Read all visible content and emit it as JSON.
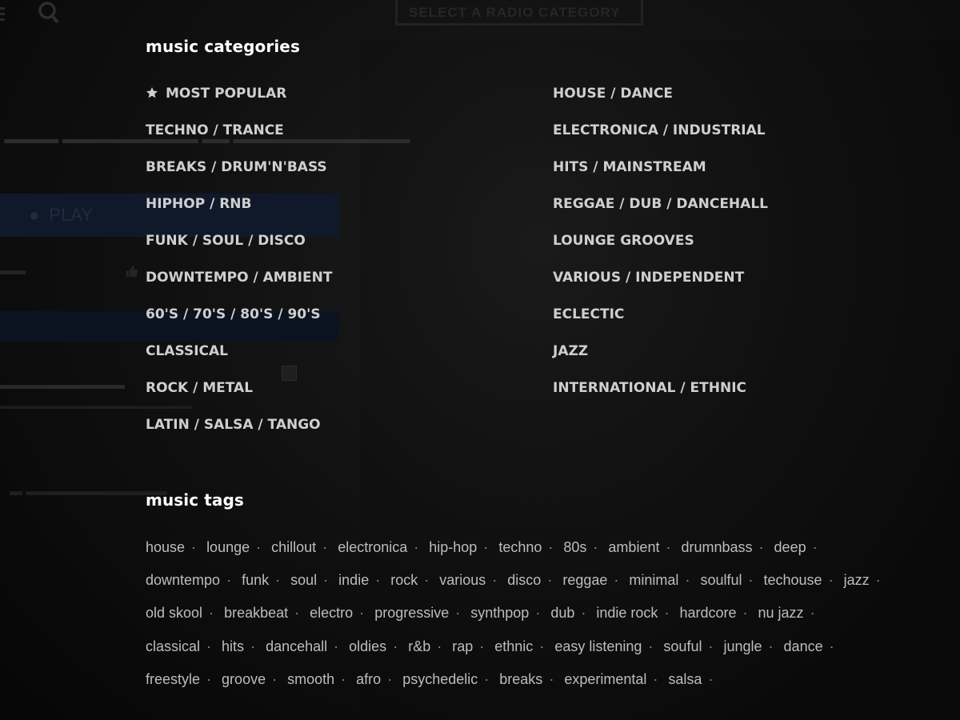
{
  "background": {
    "category_select_label": "SELECT A RADIO CATEGORY",
    "play_label": "PLAY"
  },
  "categories": {
    "heading": "music categories",
    "left": [
      {
        "label": "MOST POPULAR",
        "icon": "star-icon"
      },
      {
        "label": "TECHNO / TRANCE"
      },
      {
        "label": "BREAKS / DRUM'N'BASS"
      },
      {
        "label": "HIPHOP / RNB"
      },
      {
        "label": "FUNK / SOUL / DISCO"
      },
      {
        "label": "DOWNTEMPO / AMBIENT"
      },
      {
        "label": "60'S / 70'S / 80'S / 90'S"
      },
      {
        "label": "CLASSICAL"
      },
      {
        "label": "ROCK / METAL"
      },
      {
        "label": "LATIN / SALSA / TANGO"
      }
    ],
    "right": [
      {
        "label": "HOUSE / DANCE"
      },
      {
        "label": "ELECTRONICA / INDUSTRIAL"
      },
      {
        "label": "HITS / MAINSTREAM"
      },
      {
        "label": "REGGAE / DUB / DANCEHALL"
      },
      {
        "label": "LOUNGE GROOVES"
      },
      {
        "label": "VARIOUS / INDEPENDENT"
      },
      {
        "label": "ECLECTIC"
      },
      {
        "label": "JAZZ"
      },
      {
        "label": "INTERNATIONAL / ETHNIC"
      }
    ]
  },
  "tags": {
    "heading": "music tags",
    "separator": "·",
    "items": [
      "house",
      "lounge",
      "chillout",
      "electronica",
      "hip-hop",
      "techno",
      "80s",
      "ambient",
      "drumnbass",
      "deep",
      "downtempo",
      "funk",
      "soul",
      "indie",
      "rock",
      "various",
      "disco",
      "reggae",
      "minimal",
      "soulful",
      "techouse",
      "jazz",
      "old skool",
      "breakbeat",
      "electro",
      "progressive",
      "synthpop",
      "dub",
      "indie rock",
      "hardcore",
      "nu jazz",
      "classical",
      "hits",
      "dancehall",
      "oldies",
      "r&b",
      "rap",
      "ethnic",
      "easy listening",
      "souful",
      "jungle",
      "dance",
      "freestyle",
      "groove",
      "smooth",
      "afro",
      "psychedelic",
      "breaks",
      "experimental",
      "salsa"
    ]
  },
  "colors": {
    "heading": "#ffffff",
    "category_text": "#cfcfcf",
    "tag_text": "#bdbdbd",
    "separator": "#8a8a8a"
  }
}
